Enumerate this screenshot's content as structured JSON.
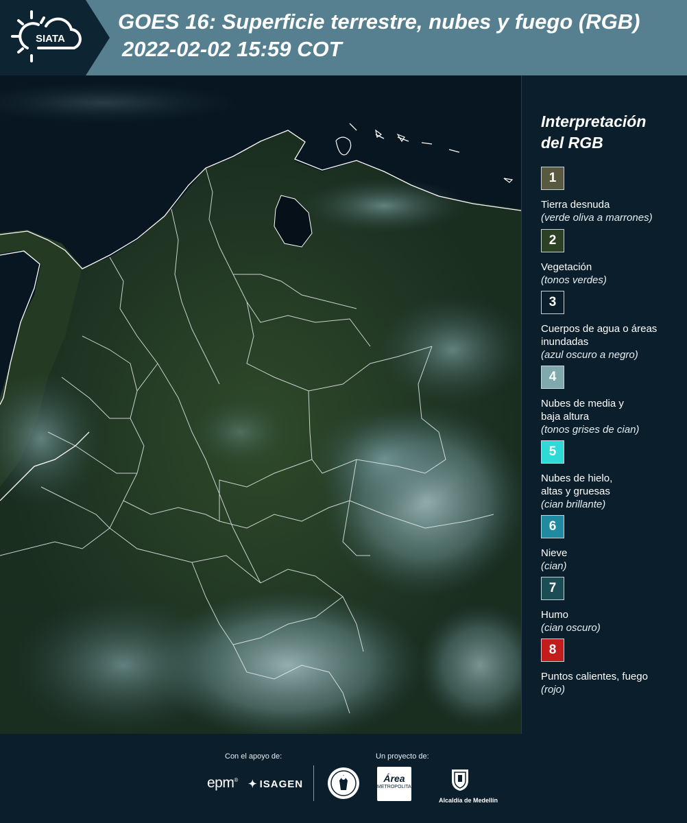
{
  "header": {
    "logo_text": "SIATA",
    "title": "GOES 16: Superficie terrestre, nubes y fuego (RGB)",
    "timestamp": "2022-02-02 15:59 COT"
  },
  "legend": {
    "title_line1": "Interpretación",
    "title_line2": "del RGB",
    "items": [
      {
        "number": "1",
        "label": "Tierra desnuda",
        "desc": "(verde oliva a marrones)",
        "color": "#59593f"
      },
      {
        "number": "2",
        "label": "Vegetación",
        "desc": "(tonos verdes)",
        "color": "#2c4024"
      },
      {
        "number": "3",
        "label": "Cuerpos de agua o áreas inundadas",
        "desc": "(azul oscuro a negro)",
        "color": "#0b1e2b"
      },
      {
        "number": "4",
        "label": "Nubes de media y baja altura",
        "desc": "(tonos grises de cian)",
        "color": "#7fa9ac"
      },
      {
        "number": "5",
        "label": "Nubes de hielo, altas y gruesas",
        "desc": "(cian brillante)",
        "color": "#2fd9d6"
      },
      {
        "number": "6",
        "label": "Nieve",
        "desc": "(cian)",
        "color": "#1f8aa0"
      },
      {
        "number": "7",
        "label": "Humo",
        "desc": "(cian oscuro)",
        "color": "#1c4c54"
      },
      {
        "number": "8",
        "label": "Puntos calientes, fuego",
        "desc": "(rojo)",
        "color": "#c21d1d"
      }
    ]
  },
  "footer": {
    "support_label": "Con el apoyo de:",
    "project_label": "Un proyecto de:",
    "epm": "epm",
    "isagen": "ISAGEN",
    "area_logo_text": "Área",
    "area_logo_sub": "METROPOLITANA",
    "alcaldia": "Alcaldía de Medellín"
  }
}
